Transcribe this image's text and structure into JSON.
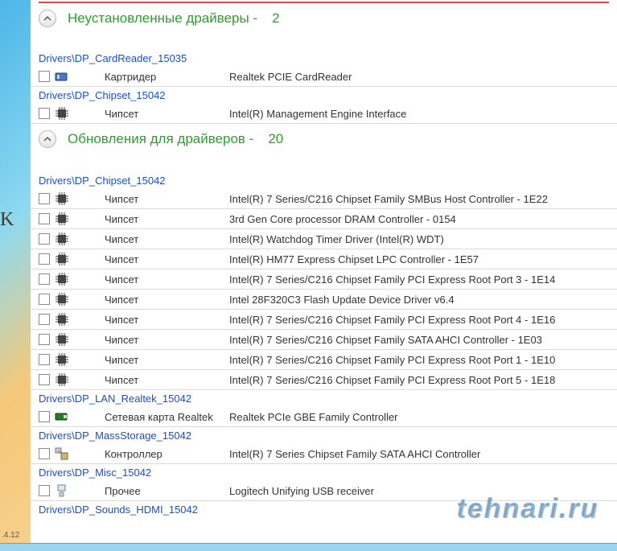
{
  "sections": {
    "uninstalled": {
      "title": "Неустановленные драйверы -",
      "count": "2"
    },
    "updates": {
      "title": "Обновления для драйверов -",
      "count": "20"
    }
  },
  "groups": {
    "cardreader": "Drivers\\DP_CardReader_15035",
    "chipset_u": "Drivers\\DP_Chipset_15042",
    "chipset": "Drivers\\DP_Chipset_15042",
    "lan": "Drivers\\DP_LAN_Realtek_15042",
    "mass": "Drivers\\DP_MassStorage_15042",
    "misc": "Drivers\\DP_Misc_15042",
    "sounds": "Drivers\\DP_Sounds_HDMI_15042"
  },
  "cat": {
    "cardreader": "Картридер",
    "chipset": "Чипсет",
    "lan": "Сетевая карта Realtek",
    "controller": "Контроллер",
    "other": "Прочее"
  },
  "rows": {
    "u1": "Realtek PCIE CardReader",
    "u2": "Intel(R) Management Engine Interface",
    "c1": "Intel(R) 7 Series/C216 Chipset Family SMBus Host Controller - 1E22",
    "c2": "3rd Gen Core processor DRAM Controller - 0154",
    "c3": "Intel(R) Watchdog Timer Driver (Intel(R) WDT)",
    "c4": "Intel(R) HM77 Express Chipset LPC Controller - 1E57",
    "c5": "Intel(R) 7 Series/C216 Chipset Family PCI Express Root Port 3 - 1E14",
    "c6": "Intel 28F320C3 Flash Update Device Driver v6.4",
    "c7": "Intel(R) 7 Series/C216 Chipset Family PCI Express Root Port 4 - 1E16",
    "c8": "Intel(R) 7 Series/C216 Chipset Family SATA AHCI Controller - 1E03",
    "c9": "Intel(R) 7 Series/C216 Chipset Family PCI Express Root Port 1 - 1E10",
    "c10": "Intel(R) 7 Series/C216 Chipset Family PCI Express Root Port 5 - 1E18",
    "lan1": "Realtek PCIe GBE Family Controller",
    "mass1": "Intel(R) 7 Series Chipset Family SATA AHCI Controller",
    "misc1": "Logitech Unifying USB receiver"
  },
  "version": ".4.12",
  "watermark": "tehnari.ru",
  "side_char": "K"
}
